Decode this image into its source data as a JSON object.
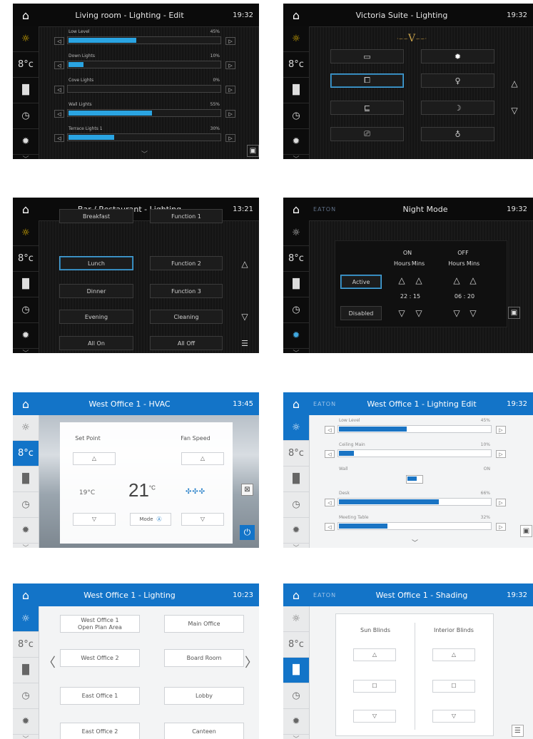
{
  "sidebar_icons": [
    "sun-icon",
    "thermometer-icon",
    "blinds-icon",
    "clock-icon",
    "gear-icon"
  ],
  "p1": {
    "title": "Living room - Lighting - Edit",
    "time": "19:32",
    "sliders": [
      {
        "label": "Low Level",
        "value": "45%",
        "fill": 0.45
      },
      {
        "label": "Down Lights",
        "value": "10%",
        "fill": 0.1
      },
      {
        "label": "Cove Lights",
        "value": "0%",
        "fill": 0.0
      },
      {
        "label": "Wall Lights",
        "value": "55%",
        "fill": 0.55
      },
      {
        "label": "Terrace Lights 1",
        "value": "30%",
        "fill": 0.3
      }
    ]
  },
  "p2": {
    "title": "Victoria Suite - Lighting",
    "time": "19:32",
    "logo_letter": "V"
  },
  "p3": {
    "title": "Bar / Restaurant - Lighting",
    "time": "13:21",
    "scenes_left": [
      "Breakfast",
      "Lunch",
      "Dinner",
      "Evening",
      "All On"
    ],
    "scenes_right": [
      "Function 1",
      "Function 2",
      "Function 3",
      "Cleaning",
      "All Off"
    ]
  },
  "p4": {
    "title": "Night Mode",
    "time": "19:32",
    "brand": "EATON",
    "on_label": "ON",
    "off_label": "OFF",
    "hours": "Hours",
    "mins": "Mins",
    "on_time": "22  :  15",
    "off_time": "06  :  20",
    "active": "Active",
    "disabled": "Disabled"
  },
  "p5": {
    "title": "West Office 1 - HVAC",
    "time": "13:45",
    "set_point": "Set Point",
    "fan_speed": "Fan Speed",
    "current": "19°C",
    "target": "21",
    "unit": "°C",
    "mode": "Mode"
  },
  "p6": {
    "title": "West Office 1 - Lighting Edit",
    "time": "19:32",
    "brand": "EATON",
    "sliders": [
      {
        "label": "Low Level",
        "value": "45%",
        "fill": 0.45
      },
      {
        "label": "Ceiling Main",
        "value": "10%",
        "fill": 0.1
      },
      {
        "label": "Wall",
        "value": "ON",
        "toggle": true
      },
      {
        "label": "Desk",
        "value": "66%",
        "fill": 0.66
      },
      {
        "label": "Meeting Table",
        "value": "32%",
        "fill": 0.32
      }
    ]
  },
  "p7": {
    "title": "West Office 1 - Lighting",
    "time": "10:23",
    "left": [
      "West Office 1\nOpen Plan Area",
      "West Office 2",
      "East Office 1",
      "East Office 2"
    ],
    "right": [
      "Main Office",
      "Board Room",
      "Lobby",
      "Canteen"
    ]
  },
  "p8": {
    "title": "West Office 1 - Shading",
    "time": "19:32",
    "brand": "EATON",
    "sun_blinds": "Sun Blinds",
    "interior_blinds": "Interior Blinds"
  }
}
